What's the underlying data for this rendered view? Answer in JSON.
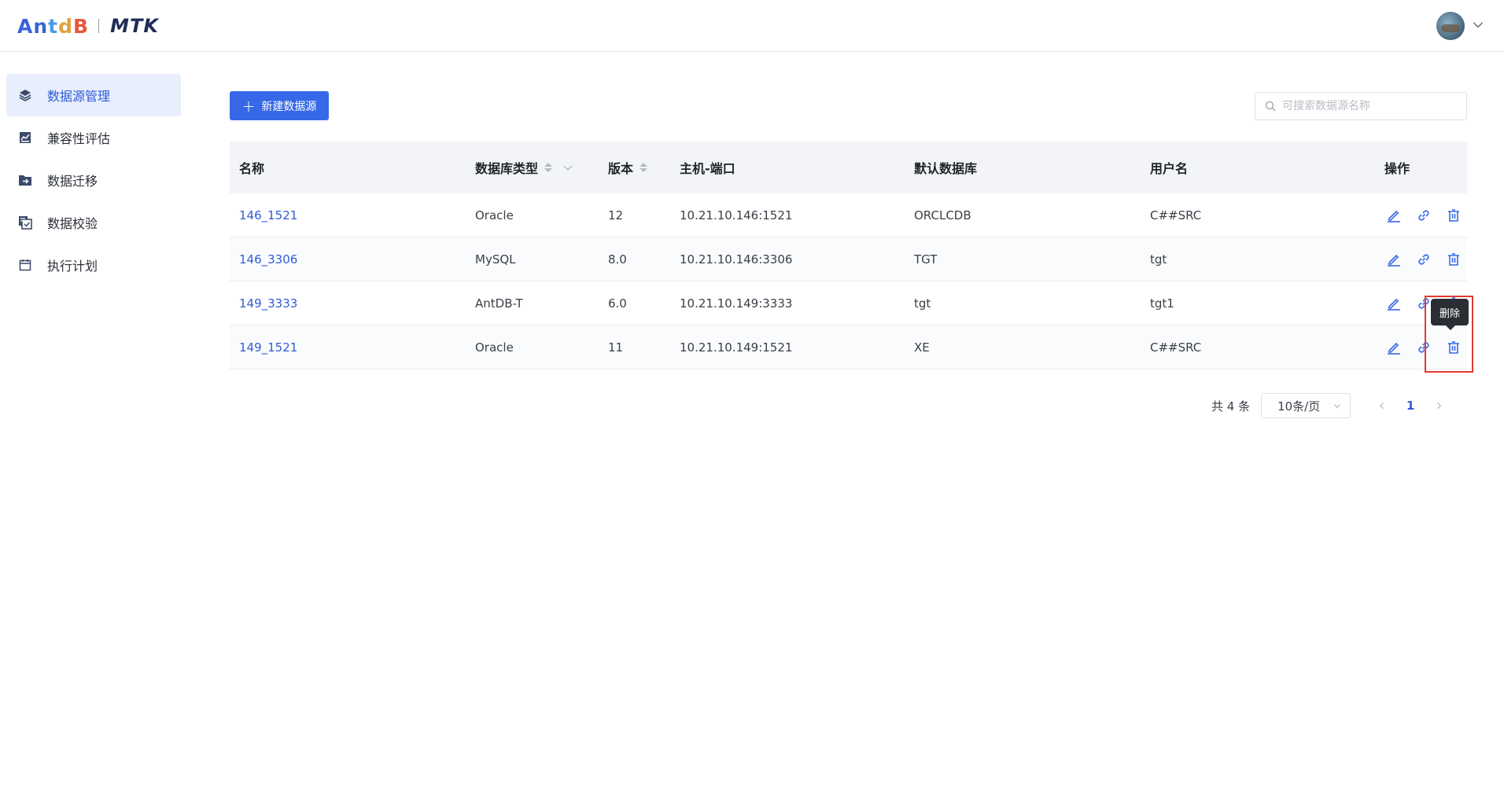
{
  "app": {
    "logo_left": "AntDB",
    "logo_right": "MTK"
  },
  "sidebar": {
    "items": [
      {
        "label": "数据源管理",
        "icon": "layers-icon",
        "active": true
      },
      {
        "label": "兼容性评估",
        "icon": "chart-box-icon",
        "active": false
      },
      {
        "label": "数据迁移",
        "icon": "folder-arrow-icon",
        "active": false
      },
      {
        "label": "数据校验",
        "icon": "copy-check-icon",
        "active": false
      },
      {
        "label": "执行计划",
        "icon": "calendar-icon",
        "active": false
      }
    ]
  },
  "toolbar": {
    "new_label": "新建数据源",
    "search_placeholder": "可搜索数据源名称"
  },
  "table": {
    "headers": [
      "名称",
      "数据库类型",
      "版本",
      "主机-端口",
      "默认数据库",
      "用户名",
      "操作"
    ],
    "rows": [
      {
        "name": "146_1521",
        "type": "Oracle",
        "version": "12",
        "host": "10.21.10.146:1521",
        "db": "ORCLCDB",
        "user": "C##SRC"
      },
      {
        "name": "146_3306",
        "type": "MySQL",
        "version": "8.0",
        "host": "10.21.10.146:3306",
        "db": "TGT",
        "user": "tgt"
      },
      {
        "name": "149_3333",
        "type": "AntDB-T",
        "version": "6.0",
        "host": "10.21.10.149:3333",
        "db": "tgt",
        "user": "tgt1"
      },
      {
        "name": "149_1521",
        "type": "Oracle",
        "version": "11",
        "host": "10.21.10.149:1521",
        "db": "XE",
        "user": "C##SRC"
      }
    ]
  },
  "tooltip": {
    "text": "删除"
  },
  "pagination": {
    "total": "共 4 条",
    "page_size": "10条/页",
    "current": "1"
  },
  "colors": {
    "primary": "#3668e8",
    "link": "#2f5bd8",
    "highlight": "#e23a32"
  }
}
